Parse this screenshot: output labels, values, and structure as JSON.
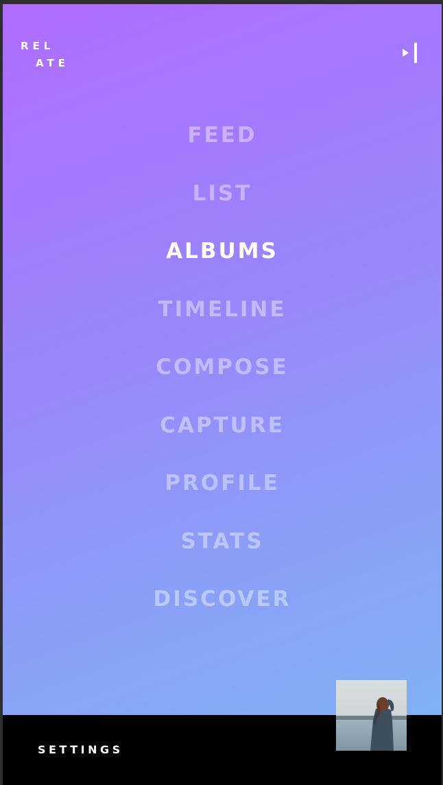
{
  "app": {
    "logo_line1": "REL",
    "logo_line2": "ATE"
  },
  "menu": {
    "items": [
      {
        "label": "FEED",
        "active": false
      },
      {
        "label": "LIST",
        "active": false
      },
      {
        "label": "ALBUMS",
        "active": true
      },
      {
        "label": "TIMELINE",
        "active": false
      },
      {
        "label": "COMPOSE",
        "active": false
      },
      {
        "label": "CAPTURE",
        "active": false
      },
      {
        "label": "PROFILE",
        "active": false
      },
      {
        "label": "STATS",
        "active": false
      },
      {
        "label": "DISCOVER",
        "active": false
      }
    ]
  },
  "footer": {
    "settings_label": "SETTINGS"
  },
  "icons": {
    "collapse": "collapse-menu-icon",
    "thumbnail": "profile-photo"
  },
  "colors": {
    "gradient_top": "#b06cff",
    "gradient_bottom": "#7db6f3",
    "footer_bg": "#000000",
    "active_text": "#ffffff"
  }
}
